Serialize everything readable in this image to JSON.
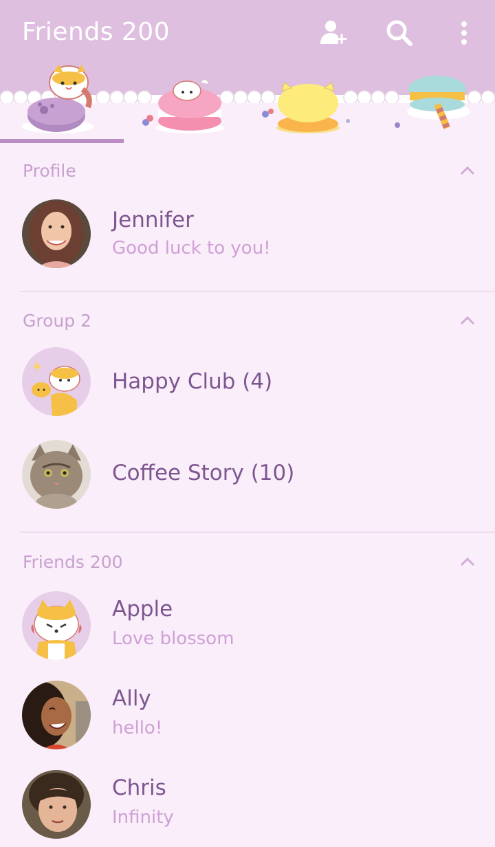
{
  "header": {
    "title": "Friends 200",
    "icons": [
      "add-friend-icon",
      "search-icon",
      "more-vertical-icon"
    ]
  },
  "tabs": [
    {
      "name": "friends-tab",
      "selected": true
    },
    {
      "name": "chats-tab",
      "selected": false
    },
    {
      "name": "timeline-tab",
      "selected": false
    },
    {
      "name": "more-tab",
      "selected": false
    }
  ],
  "sections": {
    "profile": {
      "title": "Profile",
      "items": [
        {
          "name": "Jennifer",
          "status": "Good luck to you!"
        }
      ]
    },
    "groups": {
      "title": "Group 2",
      "items": [
        {
          "name": "Happy Club (4)"
        },
        {
          "name": "Coffee Story (10)"
        }
      ]
    },
    "friends": {
      "title": "Friends 200",
      "items": [
        {
          "name": "Apple",
          "status": "Love blossom"
        },
        {
          "name": "Ally",
          "status": "hello!"
        },
        {
          "name": "Chris",
          "status": "Infinity"
        }
      ]
    }
  },
  "colors": {
    "header_bg": "#dfbfdf",
    "page_bg": "#faeefa",
    "name_text": "#7d5690",
    "secondary_text": "#cfa0d6",
    "accent": "#b98dc1"
  }
}
